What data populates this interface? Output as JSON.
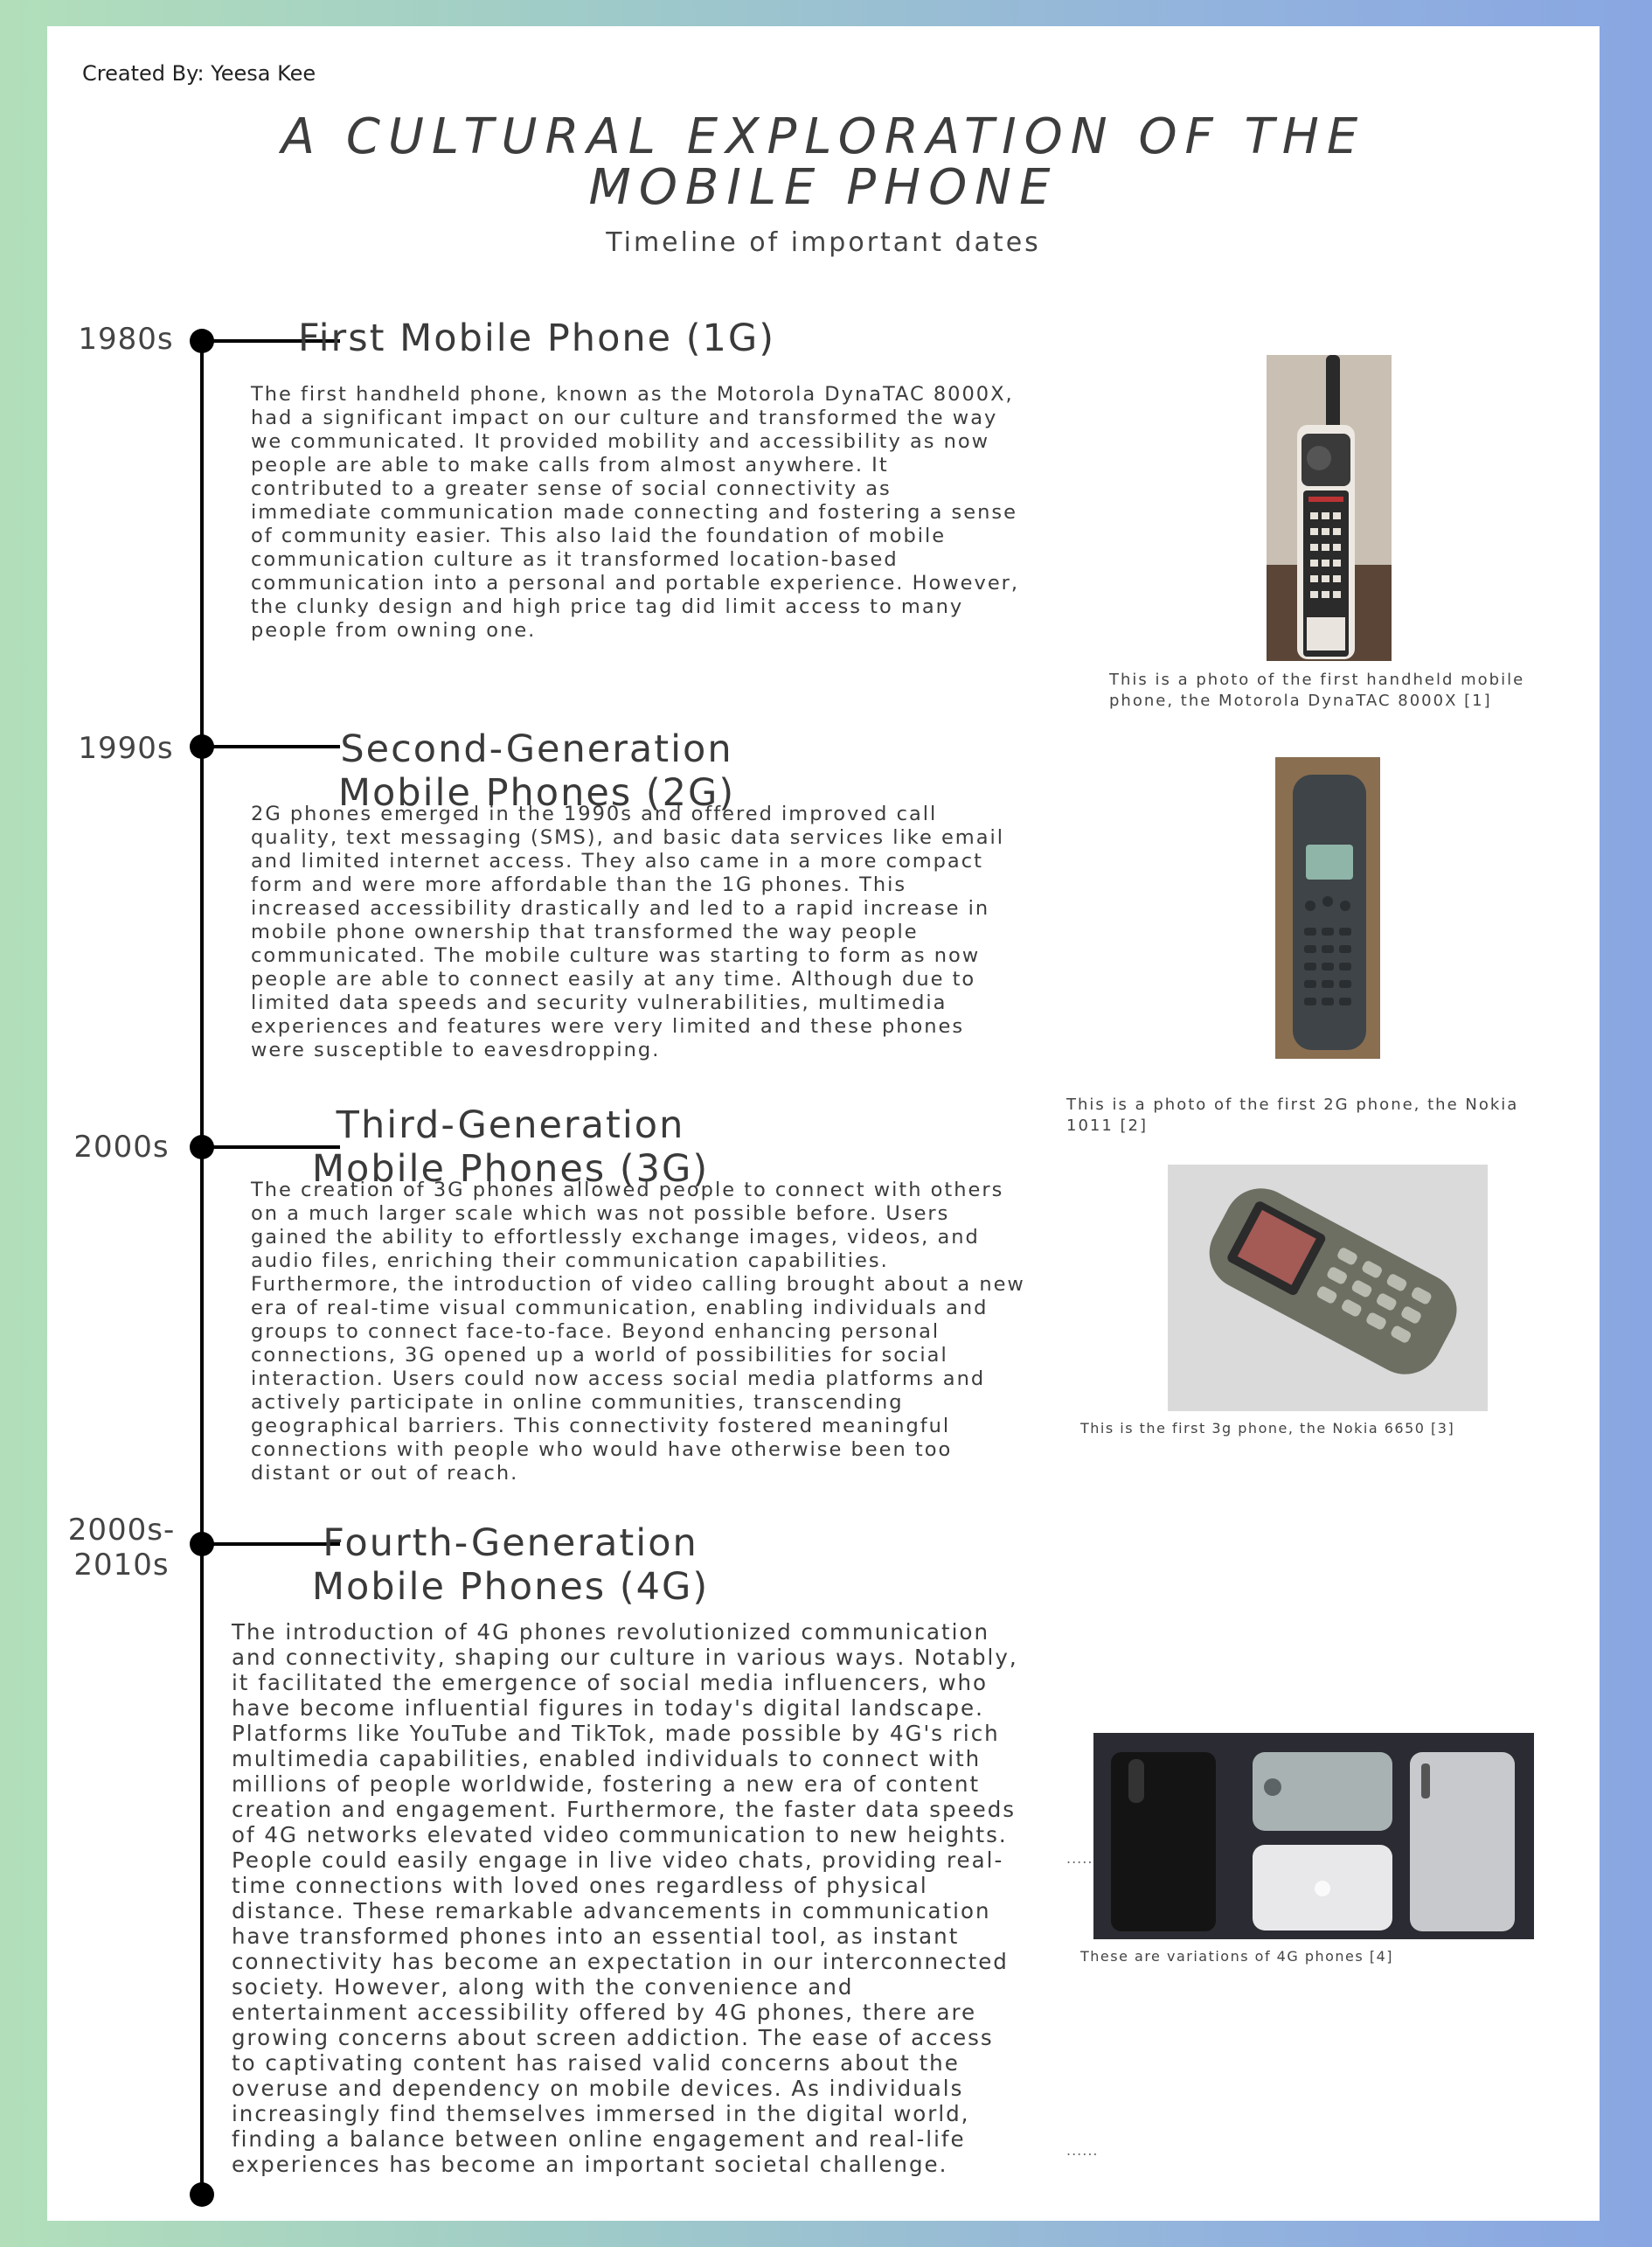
{
  "credit": "Created By: Yeesa Kee",
  "title_line1": "A CULTURAL EXPLORATION OF THE",
  "title_line2": "MOBILE PHONE",
  "subtitle": "Timeline of important dates",
  "sections": [
    {
      "era": "1980s",
      "heading_line1": "First Mobile Phone (1G)",
      "heading_line2": "",
      "body": "The first handheld phone, known as the Motorola DynaTAC 8000X, had a significant impact on our culture and transformed the way we communicated. It provided mobility and accessibility as now people are able to make calls from almost anywhere. It contributed to a greater sense of social connectivity as immediate communication made connecting and fostering a sense of community easier. This also laid the foundation of mobile communication culture as it transformed location-based communication into a personal and portable experience. However, the clunky design and high price tag did limit access to many people from owning one.",
      "caption": "This is a photo of the first handheld mobile phone, the Motorola DynaTAC 8000X [1]"
    },
    {
      "era": "1990s",
      "heading_line1": "Second-Generation",
      "heading_line2": "Mobile Phones (2G)",
      "body": "2G phones emerged in the 1990s and offered improved call quality, text messaging (SMS), and basic data services like email and limited internet access. They also came in a more compact form and were more affordable than the 1G phones. This increased accessibility drastically and led to a rapid increase in mobile phone ownership that transformed the way people communicated. The mobile culture was starting to form as now people are able to connect easily at any time. Although due to limited data speeds and security vulnerabilities, multimedia experiences and features were very limited and these phones were susceptible to eavesdropping.",
      "caption": "This is a photo of the first 2G phone, the Nokia 1011 [2]"
    },
    {
      "era": "2000s",
      "heading_line1": "Third-Generation",
      "heading_line2": "Mobile Phones (3G)",
      "body": "The creation of 3G phones allowed people to connect with others on a much larger scale which was not possible before. Users gained the ability to effortlessly exchange images, videos, and audio files, enriching their communication capabilities. Furthermore, the introduction of video calling brought about a new era of real-time visual communication, enabling individuals and groups to connect face-to-face. Beyond enhancing personal connections, 3G opened up a world of possibilities for social interaction. Users could now access social media platforms and actively participate in online communities, transcending geographical barriers. This connectivity fostered meaningful connections with people who would have otherwise been too distant or out of reach.",
      "caption": "This is the first 3g phone, the Nokia 6650 [3]"
    },
    {
      "era_line1": "2000s-",
      "era_line2": "2010s",
      "heading_line1": "Fourth-Generation",
      "heading_line2": "Mobile Phones (4G)",
      "body": "The introduction of 4G phones revolutionized communication and connectivity, shaping our culture in various ways. Notably, it facilitated the emergence of social media influencers, who have become influential figures in today's digital landscape. Platforms like YouTube and TikTok, made possible by 4G's rich multimedia capabilities, enabled individuals to connect with millions of people worldwide, fostering a new era of content creation and engagement. Furthermore, the faster data speeds of 4G networks elevated video communication to new heights. People could easily engage in live video chats, providing real-time connections with loved ones regardless of physical distance. These remarkable advancements in communication have transformed phones into an essential tool, as instant connectivity has become an expectation in our interconnected society. However, along with the convenience and entertainment accessibility offered by 4G phones, there are growing concerns about screen addiction. The ease of access to captivating content has raised valid concerns about the overuse and dependency on mobile devices. As individuals increasingly find themselves immersed in the digital world, finding a balance between online engagement and real-life experiences has become an important societal challenge.",
      "caption": "These are variations of 4G phones [4]"
    }
  ],
  "ellipsis": "......"
}
